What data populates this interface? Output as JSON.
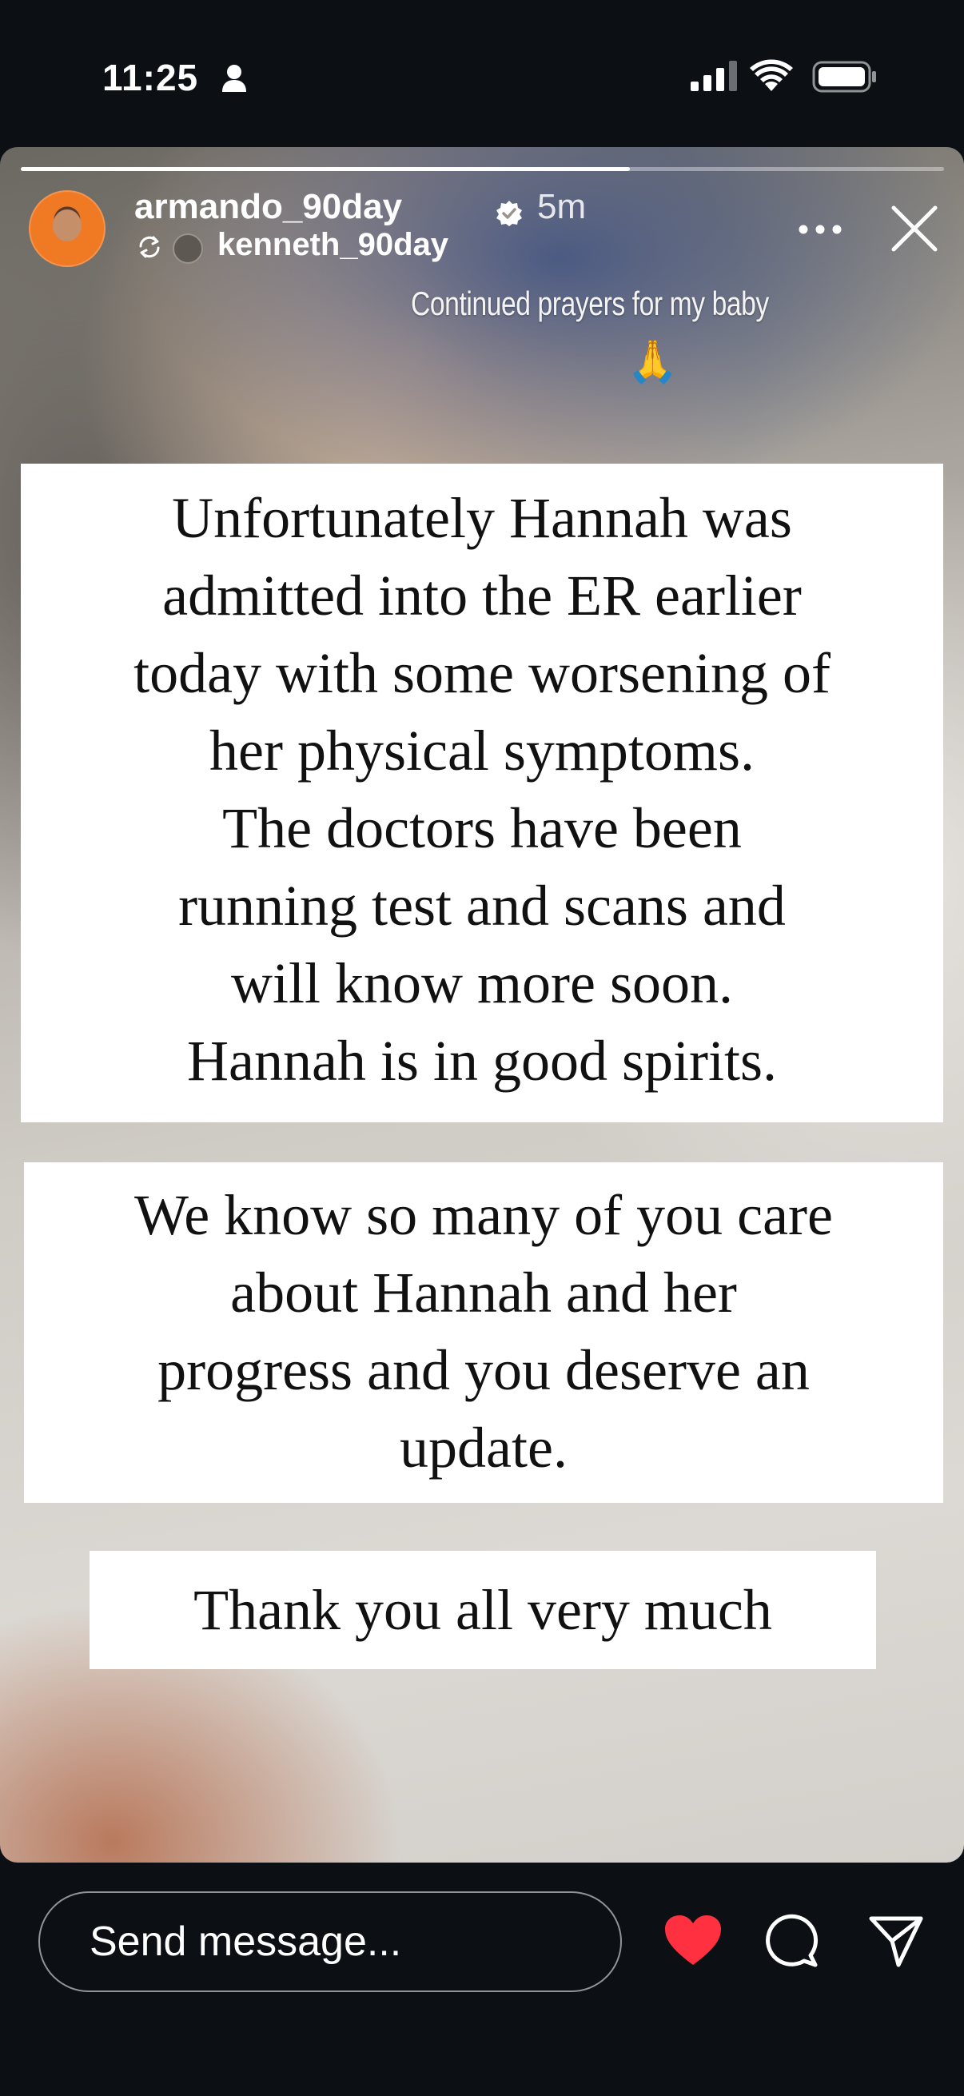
{
  "status_bar": {
    "time": "11:25"
  },
  "story": {
    "progress": 0.66,
    "username": "armando_90day",
    "time_ago": "5m",
    "reposted_from": "kenneth_90day",
    "caption": "Continued prayers for my baby",
    "caption_emoji": "🙏",
    "card1_lines": [
      "Unfortunately Hannah was",
      "admitted into the ER earlier",
      "today with some worsening of",
      "her physical symptoms.",
      "The doctors have been",
      "running test and scans and",
      "will know more soon.",
      "Hannah is in good spirits."
    ],
    "card2_lines": [
      "We know so many of you care",
      "about Hannah and her",
      "progress and you deserve an",
      "update."
    ],
    "card3_text": "Thank you all very much"
  },
  "bottom_bar": {
    "message_placeholder": "Send message...",
    "liked": true
  },
  "colors": {
    "like_red": "#ff3040",
    "background": "#0c1014",
    "verified_badge": "#ffffff"
  },
  "icons": [
    "person-icon",
    "signal-icon",
    "wifi-icon",
    "battery-icon",
    "verified-icon",
    "repost-icon",
    "more-icon",
    "close-icon",
    "heart-icon",
    "comment-icon",
    "share-icon"
  ]
}
